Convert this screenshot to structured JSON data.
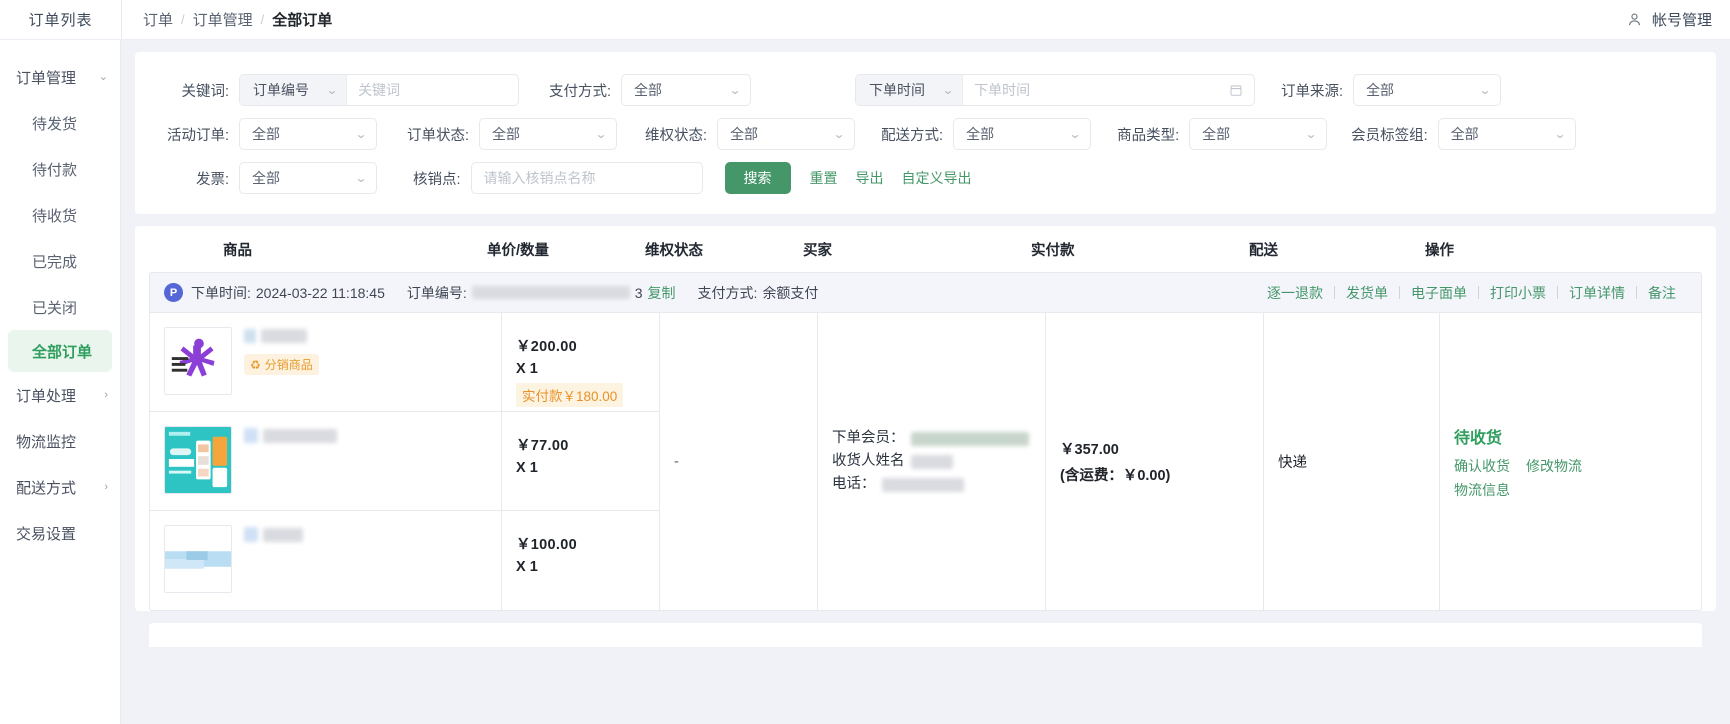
{
  "topbar": {
    "brand": "订单列表",
    "breadcrumb": [
      "订单",
      "订单管理",
      "全部订单"
    ],
    "account_label": "帐号管理",
    "user_icon": "user-icon"
  },
  "sidebar": {
    "items": [
      {
        "label": "订单管理",
        "caret": "chevron-down-icon",
        "level": "top",
        "active": false
      },
      {
        "label": "待发货",
        "level": "sub",
        "active": false
      },
      {
        "label": "待付款",
        "level": "sub",
        "active": false
      },
      {
        "label": "待收货",
        "level": "sub",
        "active": false
      },
      {
        "label": "已完成",
        "level": "sub",
        "active": false
      },
      {
        "label": "已关闭",
        "level": "sub",
        "active": false
      },
      {
        "label": "全部订单",
        "level": "sub",
        "active": true
      },
      {
        "label": "订单处理",
        "caret": "chevron-right-icon",
        "level": "top",
        "active": false
      },
      {
        "label": "物流监控",
        "level": "top",
        "active": false
      },
      {
        "label": "配送方式",
        "caret": "chevron-right-icon",
        "level": "top",
        "active": false
      },
      {
        "label": "交易设置",
        "level": "top",
        "active": false
      }
    ]
  },
  "filters": {
    "keyword": {
      "label": "关键词:",
      "prefix": "订单编号",
      "placeholder": "关键词",
      "value": ""
    },
    "pay_method": {
      "label": "支付方式:",
      "value": "全部"
    },
    "order_time": {
      "label_prefix": "下单时间",
      "placeholder": "下单时间",
      "value": "",
      "icon": "calendar-icon"
    },
    "order_source": {
      "label": "订单来源:",
      "value": "全部"
    },
    "activity_order": {
      "label": "活动订单:",
      "value": "全部"
    },
    "order_status": {
      "label": "订单状态:",
      "value": "全部"
    },
    "rights_status": {
      "label": "维权状态:",
      "value": "全部"
    },
    "ship_method": {
      "label": "配送方式:",
      "value": "全部"
    },
    "goods_type": {
      "label": "商品类型:",
      "value": "全部"
    },
    "member_tag": {
      "label": "会员标签组:",
      "value": "全部"
    },
    "invoice": {
      "label": "发票:",
      "value": "全部"
    },
    "verify_point": {
      "label": "核销点:",
      "placeholder": "请输入核销点名称",
      "value": ""
    },
    "buttons": {
      "search": "搜索",
      "reset": "重置",
      "export": "导出",
      "custom_export": "自定义导出"
    }
  },
  "table": {
    "headers": [
      "商品",
      "单价/数量",
      "维权状态",
      "买家",
      "实付款",
      "配送",
      "操作"
    ],
    "order": {
      "badge": "P",
      "time_label": "下单时间:",
      "time_value": "2024-03-22 11:18:45",
      "no_label": "订单编号:",
      "no_value_masked": "••••••••••••••••3",
      "copy_label": "复制",
      "pay_label": "支付方式:",
      "pay_value": "余额支付",
      "actions": [
        "逐一退款",
        "发货单",
        "电子面单",
        "打印小票",
        "订单详情",
        "备注"
      ]
    },
    "items": [
      {
        "title_masked": "",
        "tag": "分销商品",
        "tag_icon": "recycle-icon",
        "price": "￥200.00",
        "qty": "X 1",
        "paid_badge": "实付款￥180.00",
        "thumb": "purple-person-poster"
      },
      {
        "title_masked": "",
        "title_icon": "real-goods-icon",
        "price": "￥77.00",
        "qty": "X 1",
        "thumb": "teal-app-poster"
      },
      {
        "title_masked": "",
        "title_icon": "real-goods-icon",
        "price": "￥100.00",
        "qty": "X 1",
        "thumb": "light-blue-image"
      }
    ],
    "rights_status": "-",
    "buyer": {
      "member_label": "下单会员：",
      "receiver_label": "收货人姓名",
      "phone_label": "电话："
    },
    "paid": {
      "amount": "￥357.00",
      "freight": "(含运费：￥0.00)"
    },
    "shipping": "快递",
    "ops": {
      "status": "待收货",
      "links": [
        "确认收货",
        "修改物流",
        "物流信息"
      ]
    }
  },
  "colors": {
    "accent_green": "#45976a",
    "status_green": "#2f9e5e",
    "tag_orange": "#e8922a",
    "page_bg": "#f1f2f7",
    "order_head_bg": "#f4f5fb"
  }
}
